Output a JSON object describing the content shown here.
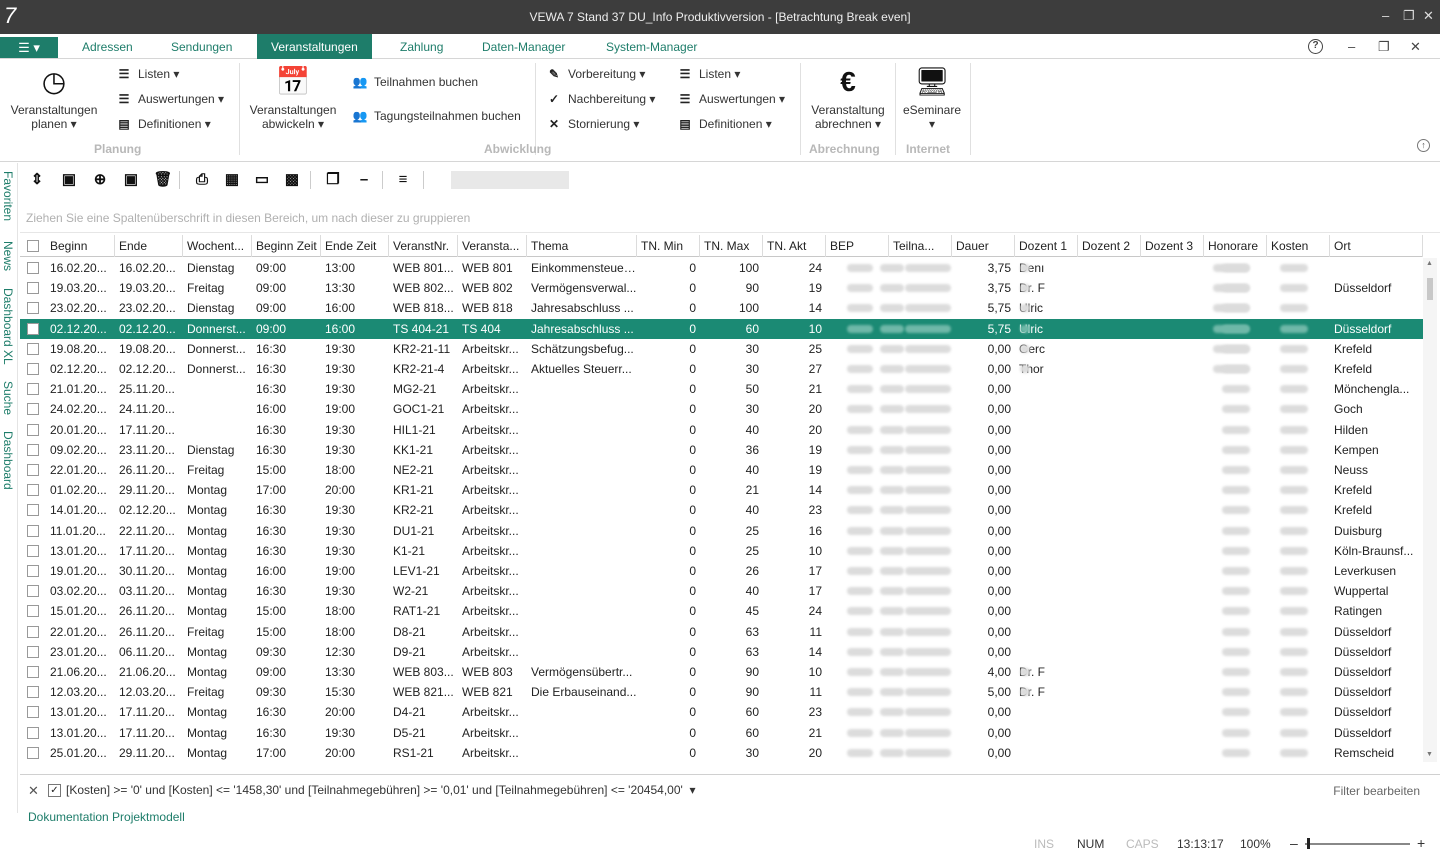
{
  "window": {
    "logo": "7",
    "title": "VEWA 7 Stand 37 DU_Info Produktivversion - [Betrachtung Break even]"
  },
  "menu": {
    "tabs": [
      "Adressen",
      "Sendungen",
      "Veranstaltungen",
      "Zahlung",
      "Daten-Manager",
      "System-Manager"
    ],
    "active_tab": "Veranstaltungen",
    "help": "?"
  },
  "ribbon": {
    "planen_label": "Veranstaltungen planen",
    "listen": "Listen",
    "auswertungen": "Auswertungen",
    "definitionen": "Definitionen",
    "planung_caption": "Planung",
    "abwickeln_label": "Veranstaltungen abwickeln",
    "teilnahmen_buchen": "Teilnahmen buchen",
    "tagung_buchen": "Tagungsteilnahmen buchen",
    "vorbereitung": "Vorbereitung",
    "nachbereitung": "Nachbereitung",
    "stornierung": "Stornierung",
    "listen2": "Listen",
    "auswertungen2": "Auswertungen",
    "definitionen2": "Definitionen",
    "abwicklung_caption": "Abwicklung",
    "abrechnen_label": "Veranstaltung abrechnen",
    "abrechnung_caption": "Abrechnung",
    "eseminare_label": "eSeminare",
    "internet_caption": "Internet"
  },
  "sidebar": [
    "Favoriten",
    "News",
    "Dashboard XL",
    "Suche",
    "Dashboard"
  ],
  "group_hint": "Ziehen Sie eine Spaltenüberschrift in diesen Bereich, um nach dieser zu gruppieren",
  "columns": [
    "Beginn",
    "Ende",
    "Wochent...",
    "Beginn Zeit",
    "Ende Zeit",
    "VeranstNr.",
    "Veransta...",
    "Thema",
    "TN. Min",
    "TN. Max",
    "TN. Akt",
    "BEP",
    "Teilna...",
    "Dauer",
    "Dozent 1",
    "Dozent 2",
    "Dozent 3",
    "Honorare",
    "Kosten",
    "Ort"
  ],
  "rows": [
    [
      "16.02.20...",
      "16.02.20...",
      "Dienstag",
      "09:00",
      "13:00",
      "WEB 801...",
      "WEB 801",
      "Einkommensteuer...",
      "0",
      "100",
      "24",
      "3,75",
      "Denı",
      "",
      ""
    ],
    [
      "19.03.20...",
      "19.03.20...",
      "Freitag",
      "09:00",
      "13:30",
      "WEB 802...",
      "WEB 802",
      "Vermögensverwal...",
      "0",
      "90",
      "19",
      "3,75",
      "Dr. F",
      "",
      "Düsseldorf"
    ],
    [
      "23.02.20...",
      "23.02.20...",
      "Dienstag",
      "09:00",
      "16:00",
      "WEB 818...",
      "WEB 818",
      "Jahresabschluss ...",
      "0",
      "100",
      "14",
      "5,75",
      "Ulric",
      "",
      ""
    ],
    [
      "02.12.20...",
      "02.12.20...",
      "Donnerst...",
      "09:00",
      "16:00",
      "TS 404-21",
      "TS 404",
      "Jahresabschluss ...",
      "0",
      "60",
      "10",
      "5,75",
      "Ulric",
      "",
      "Düsseldorf"
    ],
    [
      "19.08.20...",
      "19.08.20...",
      "Donnerst...",
      "16:30",
      "19:30",
      "KR2-21-11",
      "Arbeitskr...",
      "Schätzungsbefug...",
      "0",
      "30",
      "25",
      "0,00",
      "Gerc",
      "",
      "Krefeld"
    ],
    [
      "02.12.20...",
      "02.12.20...",
      "Donnerst...",
      "16:30",
      "19:30",
      "KR2-21-4",
      "Arbeitskr...",
      "Aktuelles Steuerr...",
      "0",
      "30",
      "27",
      "0,00",
      "Thor",
      "",
      "Krefeld"
    ],
    [
      "21.01.20...",
      "25.11.20...",
      "",
      "16:30",
      "19:30",
      "MG2-21",
      "Arbeitskr...",
      "",
      "0",
      "50",
      "21",
      "0,00",
      "",
      "",
      "Mönchengla..."
    ],
    [
      "24.02.20...",
      "24.11.20...",
      "",
      "16:00",
      "19:00",
      "GOC1-21",
      "Arbeitskr...",
      "",
      "0",
      "30",
      "20",
      "0,00",
      "",
      "",
      "Goch"
    ],
    [
      "20.01.20...",
      "17.11.20...",
      "",
      "16:30",
      "19:30",
      "HIL1-21",
      "Arbeitskr...",
      "",
      "0",
      "40",
      "20",
      "0,00",
      "",
      "",
      "Hilden"
    ],
    [
      "09.02.20...",
      "23.11.20...",
      "Dienstag",
      "16:30",
      "19:30",
      "KK1-21",
      "Arbeitskr...",
      "",
      "0",
      "36",
      "19",
      "0,00",
      "",
      "",
      "Kempen"
    ],
    [
      "22.01.20...",
      "26.11.20...",
      "Freitag",
      "15:00",
      "18:00",
      "NE2-21",
      "Arbeitskr...",
      "",
      "0",
      "40",
      "19",
      "0,00",
      "",
      "",
      "Neuss"
    ],
    [
      "01.02.20...",
      "29.11.20...",
      "Montag",
      "17:00",
      "20:00",
      "KR1-21",
      "Arbeitskr...",
      "",
      "0",
      "21",
      "14",
      "0,00",
      "",
      "",
      "Krefeld"
    ],
    [
      "14.01.20...",
      "02.12.20...",
      "Montag",
      "16:30",
      "19:30",
      "KR2-21",
      "Arbeitskr...",
      "",
      "0",
      "40",
      "23",
      "0,00",
      "",
      "",
      "Krefeld"
    ],
    [
      "11.01.20...",
      "22.11.20...",
      "Montag",
      "16:30",
      "19:30",
      "DU1-21",
      "Arbeitskr...",
      "",
      "0",
      "25",
      "16",
      "0,00",
      "",
      "",
      "Duisburg"
    ],
    [
      "13.01.20...",
      "17.11.20...",
      "Montag",
      "16:30",
      "19:30",
      "K1-21",
      "Arbeitskr...",
      "",
      "0",
      "25",
      "10",
      "0,00",
      "",
      "",
      "Köln-Braunsf..."
    ],
    [
      "19.01.20...",
      "30.11.20...",
      "Montag",
      "16:00",
      "19:00",
      "LEV1-21",
      "Arbeitskr...",
      "",
      "0",
      "26",
      "17",
      "0,00",
      "",
      "",
      "Leverkusen"
    ],
    [
      "03.02.20...",
      "03.11.20...",
      "Montag",
      "16:30",
      "19:30",
      "W2-21",
      "Arbeitskr...",
      "",
      "0",
      "40",
      "17",
      "0,00",
      "",
      "",
      "Wuppertal"
    ],
    [
      "15.01.20...",
      "26.11.20...",
      "Montag",
      "15:00",
      "18:00",
      "RAT1-21",
      "Arbeitskr...",
      "",
      "0",
      "45",
      "24",
      "0,00",
      "",
      "",
      "Ratingen"
    ],
    [
      "22.01.20...",
      "26.11.20...",
      "Freitag",
      "15:00",
      "18:00",
      "D8-21",
      "Arbeitskr...",
      "",
      "0",
      "63",
      "11",
      "0,00",
      "",
      "",
      "Düsseldorf"
    ],
    [
      "23.01.20...",
      "06.11.20...",
      "Montag",
      "09:30",
      "12:30",
      "D9-21",
      "Arbeitskr...",
      "",
      "0",
      "63",
      "14",
      "0,00",
      "",
      "",
      "Düsseldorf"
    ],
    [
      "21.06.20...",
      "21.06.20...",
      "Montag",
      "09:00",
      "13:30",
      "WEB 803...",
      "WEB 803",
      "Vermögensübertr...",
      "0",
      "90",
      "10",
      "4,00",
      "Dr. F",
      "",
      "Düsseldorf"
    ],
    [
      "12.03.20...",
      "12.03.20...",
      "Freitag",
      "09:30",
      "15:30",
      "WEB 821...",
      "WEB 821",
      "Die Erbauseinand...",
      "0",
      "90",
      "11",
      "5,00",
      "Dr. F",
      "",
      "Düsseldorf"
    ],
    [
      "13.01.20...",
      "17.11.20...",
      "Montag",
      "16:30",
      "20:00",
      "D4-21",
      "Arbeitskr...",
      "",
      "0",
      "60",
      "23",
      "0,00",
      "",
      "",
      "Düsseldorf"
    ],
    [
      "13.01.20...",
      "17.11.20...",
      "Montag",
      "16:30",
      "19:30",
      "D5-21",
      "Arbeitskr...",
      "",
      "0",
      "60",
      "21",
      "0,00",
      "",
      "",
      "Düsseldorf"
    ],
    [
      "25.01.20...",
      "29.11.20...",
      "Montag",
      "17:00",
      "20:00",
      "RS1-21",
      "Arbeitskr...",
      "",
      "0",
      "30",
      "20",
      "0,00",
      "",
      "",
      "Remscheid"
    ]
  ],
  "selected_row": 3,
  "filter": {
    "text": "[Kosten] >= '0' und [Kosten] <= '1458,30' und [Teilnahmegebühren] >= '0,01' und [Teilnahmegebühren] <= '20454,00'",
    "edit": "Filter bearbeiten",
    "checked": true
  },
  "doc_link": "Dokumentation Projektmodell",
  "status": {
    "ins": "INS",
    "num": "NUM",
    "caps": "CAPS",
    "time": "13:13:17",
    "zoom": "100%"
  },
  "colors": {
    "accent": "#1e7d6a",
    "selection": "#1b8a74",
    "titlebar": "#3d3d3d"
  }
}
